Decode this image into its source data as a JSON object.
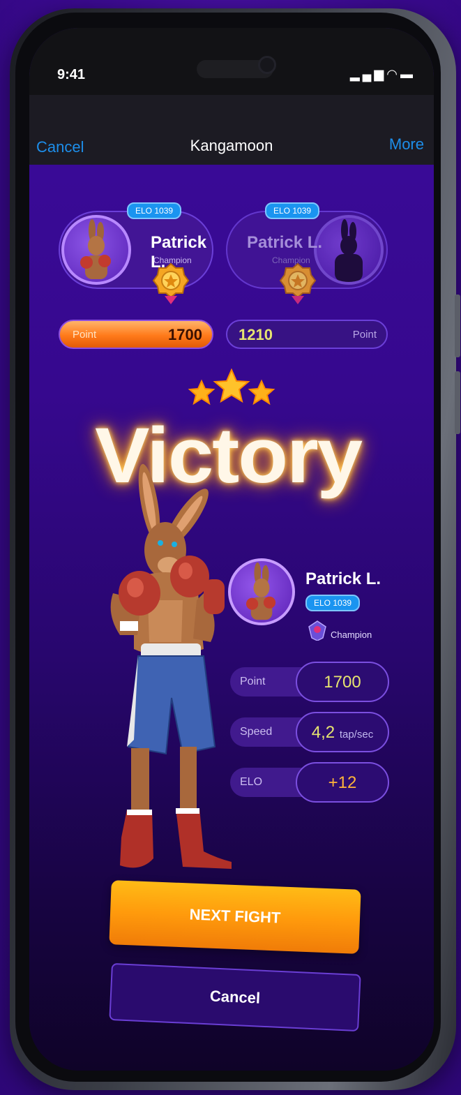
{
  "status_bar": {
    "time": "9:41",
    "signal_icon": "signal-icon",
    "wifi_icon": "wifi-icon",
    "battery_icon": "battery-icon"
  },
  "nav": {
    "cancel": "Cancel",
    "title": "Kangamoon",
    "more": "More"
  },
  "player1": {
    "name": "Patrick L.",
    "rank": "Champion",
    "elo": "ELO 1039",
    "point_label": "Point",
    "points": "1700"
  },
  "player2": {
    "name": "Patrick L.",
    "rank": "Champion",
    "elo": "ELO 1039",
    "point_label": "Point",
    "points": "1210"
  },
  "result": {
    "title": "Victory",
    "stars": 3
  },
  "summary": {
    "name": "Patrick L.",
    "elo": "ELO 1039",
    "rank": "Champion",
    "stats": [
      {
        "label": "Point",
        "value": "1700",
        "unit": ""
      },
      {
        "label": "Speed",
        "value": "4,2",
        "unit": "tap/sec"
      },
      {
        "label": "ELO",
        "value": "+12",
        "unit": ""
      }
    ]
  },
  "actions": {
    "next": "NEXT FIGHT",
    "cancel": "Cancel"
  },
  "colors": {
    "accent": "#1d8eea",
    "primary_button": "#ff9a0c",
    "background": "#3a0990"
  }
}
